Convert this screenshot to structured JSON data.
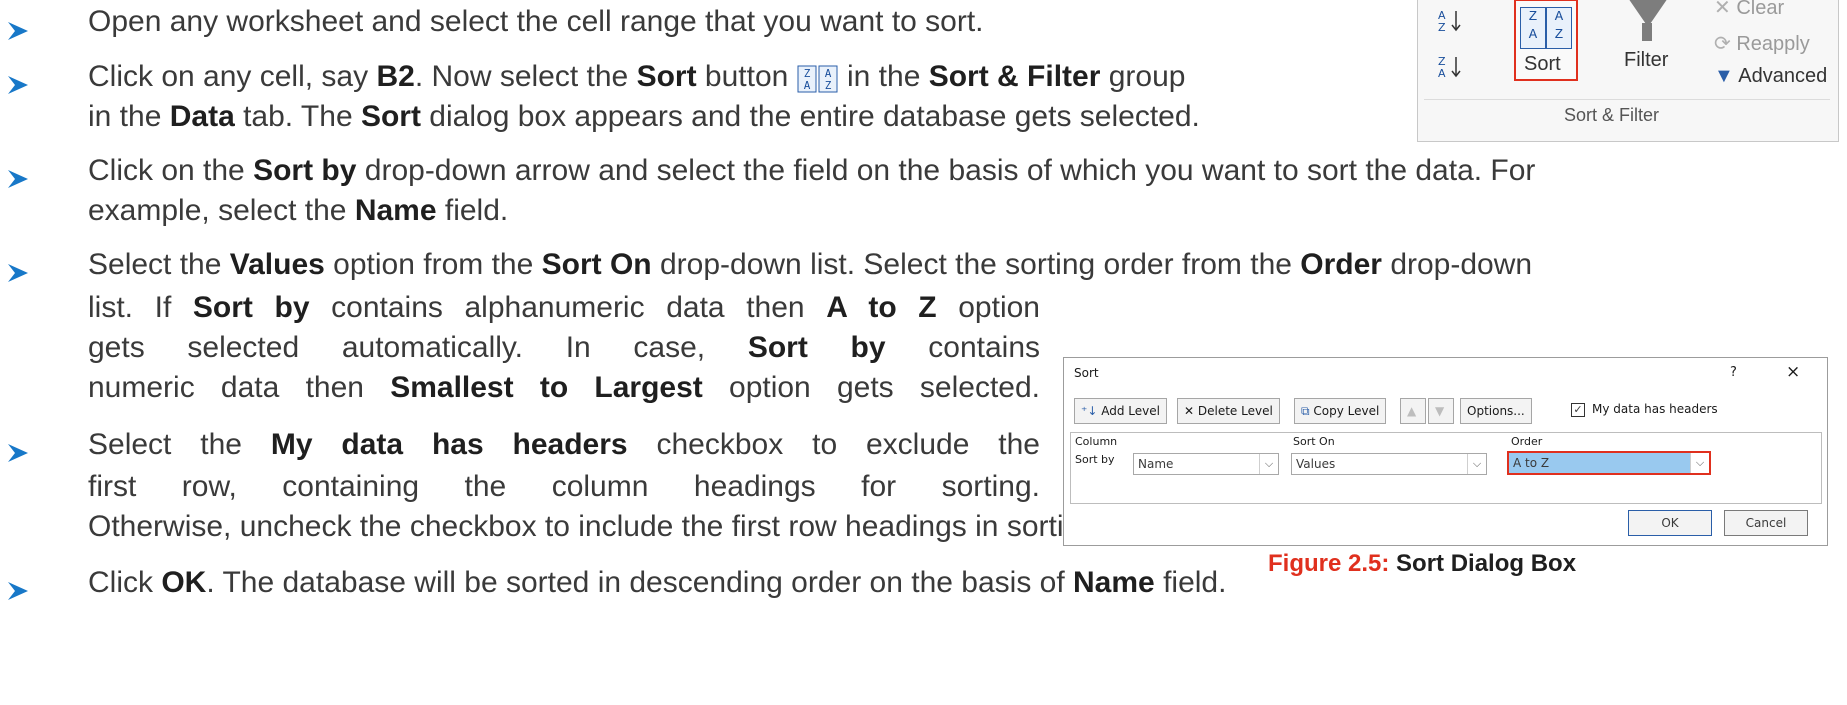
{
  "bullets": {
    "b1": [
      "Open any worksheet and select the cell range that you want to sort."
    ],
    "b2_line1": [
      "Click on any cell, say ",
      "B2",
      ". Now select the ",
      "Sort",
      " button ",
      " in the ",
      "Sort & Filter",
      " group"
    ],
    "b2_line2": [
      "in the ",
      "Data",
      " tab. The ",
      "Sort",
      " dialog box appears and the entire database gets selected."
    ],
    "b3_line1": [
      "Click on the ",
      "Sort by",
      " drop-down arrow and select the field on the basis of which you want to sort the data. For"
    ],
    "b3_line2": [
      "example, select  the ",
      "Name",
      " field."
    ],
    "b4_line1": [
      "Select the ",
      "Values",
      " option from the ",
      "Sort On",
      " drop-down list. Select the sorting order from the ",
      "Order",
      " drop-down"
    ],
    "b4_line2": [
      "list. If ",
      "Sort by",
      " contains alphanumeric data then ",
      "A to Z",
      " option"
    ],
    "b4_line3": [
      "gets selected automatically. In case, ",
      "Sort by",
      " contains"
    ],
    "b4_line4": [
      "numeric data then ",
      "Smallest to Largest",
      " option gets selected."
    ],
    "b5_line1": [
      "Select the ",
      "My data has headers",
      " checkbox to exclude the"
    ],
    "b5_line2": [
      "first row, containing the column headings for sorting."
    ],
    "b5_line3": [
      "Otherwise, uncheck the checkbox to include the first row headings in sorting."
    ],
    "b6_line1": [
      "Click ",
      "OK",
      ". The database will be sorted in descending order on the basis of ",
      "Name",
      " field."
    ]
  },
  "ribbon": {
    "sort_label": "Sort",
    "filter_label": "Filter",
    "clear_label": "Clear",
    "reapply_label": "Reapply",
    "advanced_label": "Advanced",
    "group_label": "Sort & Filter",
    "az_small": "A↓Z",
    "za_small": "Z↓A"
  },
  "dialog": {
    "title": "Sort",
    "help": "?",
    "close": "×",
    "add_level": "Add Level",
    "delete_level": "Delete Level",
    "copy_level": "Copy Level",
    "options": "Options...",
    "headers_checkbox": "My data has headers",
    "col_column": "Column",
    "col_sort_on": "Sort On",
    "col_order": "Order",
    "row_label": "Sort by",
    "sort_by_value": "Name",
    "sort_on_value": "Values",
    "order_value": "A to Z",
    "ok": "OK",
    "cancel": "Cancel"
  },
  "caption": {
    "number": "Figure 2.5:",
    "text": "Sort Dialog Box"
  },
  "colors": {
    "bullet": "#1878c8",
    "caption_red": "#e0301e",
    "highlight_red": "#e0301e",
    "selection_blue": "#99c9ef"
  },
  "icons": [
    "bullet-arrow-icon",
    "sort-az-icon",
    "sort-za-icon",
    "filter-funnel-icon",
    "clear-icon",
    "reapply-icon",
    "advanced-icon",
    "dropdown-arrow-icon",
    "checkbox-icon"
  ]
}
